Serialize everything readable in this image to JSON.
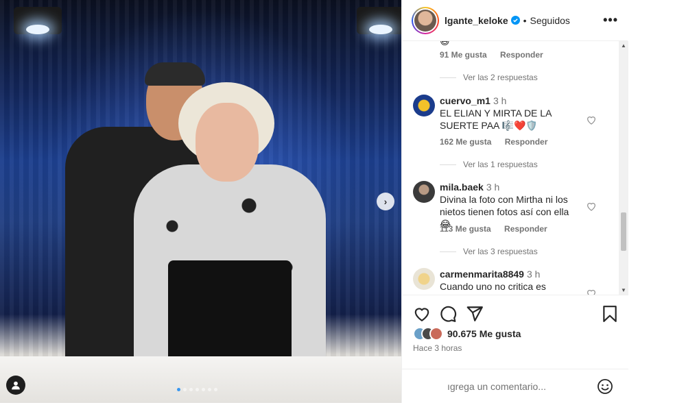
{
  "post": {
    "user": "lgante_keloke",
    "follow_status": "Seguidos",
    "likes_count": "90.675",
    "likes_label": "Me gusta",
    "time_ago": "Hace 3 horas"
  },
  "comments": [
    {
      "likes": "91 Me gusta",
      "reply": "Responder",
      "view_replies": "Ver las 2 respuestas"
    },
    {
      "user": "cuervo_m1",
      "time": "3 h",
      "text": "EL ELIAN Y MIRTA DE LA SUERTE PAA 🎼❤️🛡️",
      "likes": "162 Me gusta",
      "reply": "Responder",
      "view_replies": "Ver las 1 respuestas"
    },
    {
      "user": "mila.baek",
      "time": "3 h",
      "text": "Divina la foto con Mirtha ni los nietos tienen fotos así con ella 😂",
      "likes": "113 Me gusta",
      "reply": "Responder",
      "view_replies": "Ver las 3 respuestas"
    },
    {
      "user": "carmenmarita8849",
      "time": "3 h",
      "text": "Cuando uno no critica es"
    }
  ],
  "composer": {
    "placeholder": "ıgrega un comentario..."
  },
  "icons": {
    "like": "heart-icon",
    "comment": "comment-icon",
    "share": "send-icon",
    "save": "bookmark-icon",
    "next": "chevron-right-icon",
    "tag": "user-tag-icon",
    "emoji": "emoji-icon",
    "more": "more-icon"
  },
  "colors": {
    "verified": "#0095f6",
    "carousel_active": "#3897f0",
    "meta_text": "#737373"
  }
}
